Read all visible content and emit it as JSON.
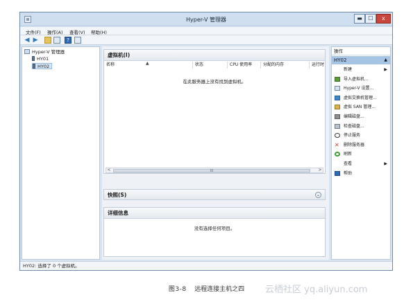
{
  "window": {
    "title": "Hyper-V 管理器",
    "controls": {
      "minimize": "▬",
      "maximize": "☐",
      "close": "x"
    }
  },
  "menubar": {
    "items": [
      "文件(F)",
      "操作(A)",
      "查看(V)",
      "帮助(H)"
    ]
  },
  "tree": {
    "root": "Hyper-V 管理器",
    "servers": [
      "HY01",
      "HY02"
    ],
    "selected": "HY02"
  },
  "vm_panel": {
    "heading": "虚拟机(I)",
    "columns": [
      "名称",
      "状态",
      "CPU 使用率",
      "分配的内存",
      "运行时"
    ],
    "empty_message": "在此服务器上没有找到虚拟机。",
    "scroll_grip": "III",
    "scroll_left": "<",
    "scroll_right": ">"
  },
  "snapshot_panel": {
    "heading": "快照(S)",
    "collapse_icon": "⌄"
  },
  "detail_panel": {
    "heading": "详细信息",
    "empty_message": "没有选择任何项目。"
  },
  "actions": {
    "title": "操作",
    "server": "HY02",
    "items": [
      {
        "label": "新建",
        "icon": "none",
        "submenu": true
      },
      {
        "label": "导入虚拟机...",
        "icon": "import-icon",
        "submenu": false
      },
      {
        "label": "Hyper-V 设置...",
        "icon": "settings-icon",
        "submenu": false
      },
      {
        "label": "虚拟交换机管理...",
        "icon": "switch-icon",
        "submenu": false
      },
      {
        "label": "虚拟 SAN 管理...",
        "icon": "san-icon",
        "submenu": false
      },
      {
        "label": "编辑磁盘...",
        "icon": "edit-disk-icon",
        "submenu": false
      },
      {
        "label": "检查磁盘...",
        "icon": "inspect-disk-icon",
        "submenu": false
      },
      {
        "label": "停止服务",
        "icon": "stop-icon",
        "submenu": false
      },
      {
        "label": "删除服务器",
        "icon": "delete-icon",
        "submenu": false
      },
      {
        "label": "刷新",
        "icon": "refresh-icon",
        "submenu": false
      },
      {
        "label": "查看",
        "icon": "none",
        "submenu": true
      },
      {
        "label": "帮助",
        "icon": "help-icon",
        "submenu": false
      }
    ]
  },
  "statusbar": {
    "text": "HY02:  选择了 0 个虚拟机。"
  },
  "caption": {
    "figure": "图3-8",
    "text": "远程连接主机之四"
  },
  "watermark": "云栖社区 yq.aliyun.com",
  "colors": {
    "titlebar": "#cfdff0",
    "selection": "#a6c4e4",
    "close_button": "#c9463d"
  }
}
